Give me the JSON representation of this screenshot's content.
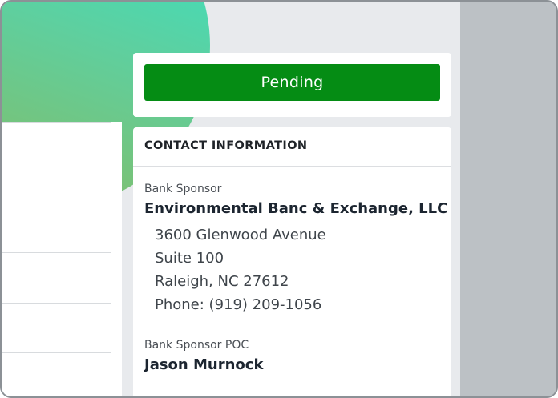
{
  "status": {
    "label": "Pending",
    "color": "#058c14"
  },
  "contact": {
    "title": "CONTACT INFORMATION",
    "sponsor_label": "Bank Sponsor",
    "sponsor_name": "Environmental Banc & Exchange, LLC",
    "address": [
      "3600 Glenwood Avenue",
      "Suite 100",
      "Raleigh, NC 27612",
      "Phone: (919) 209-1056"
    ],
    "poc_label": "Bank Sponsor POC",
    "poc_name": "Jason Murnock"
  },
  "colors": {
    "accent_green": "#058c14",
    "gradient_start": "#2ee6cc",
    "gradient_end": "#8cb85a"
  }
}
